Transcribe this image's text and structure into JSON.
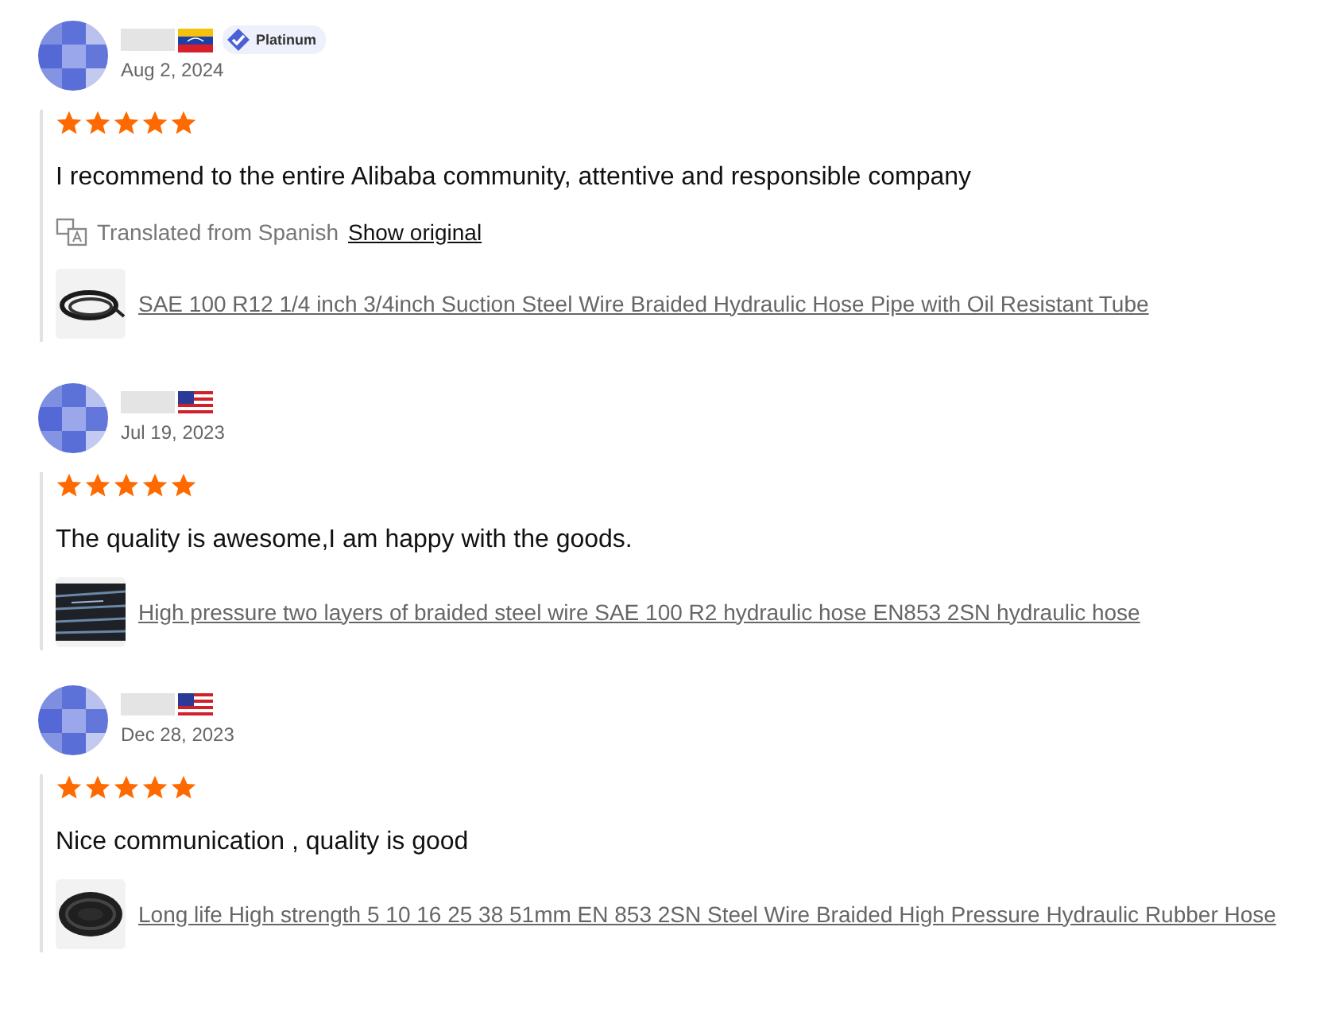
{
  "reviews": [
    {
      "badge": "Platinum",
      "date": "Aug 2, 2024",
      "stars": 5,
      "text": "I recommend to the entire Alibaba community, attentive and responsible company",
      "translation": {
        "note": "Translated from Spanish",
        "link": "Show original"
      },
      "product": {
        "title": "SAE 100 R12 1/4 inch 3/4inch Suction Steel Wire Braided Hydraulic Hose Pipe with Oil Resistant Tube"
      }
    },
    {
      "date": "Jul 19, 2023",
      "stars": 5,
      "text": "The quality is awesome,I am happy with the goods.",
      "product": {
        "title": "High pressure two layers of braided steel wire SAE 100 R2 hydraulic hose EN853 2SN hydraulic hose"
      }
    },
    {
      "date": "Dec 28, 2023",
      "stars": 5,
      "text": "Nice communication , quality is good",
      "product": {
        "title": "Long life High strength 5 10 16 25 38 51mm EN 853 2SN Steel Wire Braided High Pressure Hydraulic Rubber Hose"
      }
    }
  ]
}
